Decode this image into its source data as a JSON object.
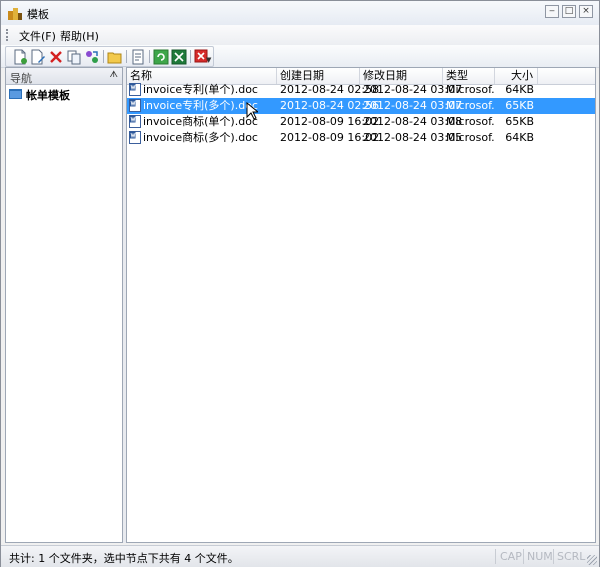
{
  "window": {
    "title": "模板"
  },
  "menu": [
    {
      "label": "文件(F)"
    },
    {
      "label": "帮助(H)"
    }
  ],
  "toolbar": {
    "icons": [
      "new-icon",
      "edit-icon",
      "delete-icon",
      "copy-icon",
      "refresh-sync-icon",
      "folder-open-icon",
      "document-icon",
      "reload-icon",
      "excel-icon",
      "close-red-icon"
    ]
  },
  "nav": {
    "header": "导航",
    "pin_glyph": "ᗑ",
    "items": [
      {
        "label": "帐单模板"
      }
    ]
  },
  "list": {
    "columns": [
      "名称",
      "创建日期",
      "修改日期",
      "类型",
      "大小"
    ],
    "rows": [
      {
        "name": "invoice专利(单个).doc",
        "created": "2012-08-24 02:58",
        "modified": "2012-08-24 03:07",
        "type": "Microsof...",
        "size": "64KB",
        "selected": false
      },
      {
        "name": "invoice专利(多个).doc",
        "created": "2012-08-24 02:56",
        "modified": "2012-08-24 03:07",
        "type": "Microsof...",
        "size": "65KB",
        "selected": true
      },
      {
        "name": "invoice商标(单个).doc",
        "created": "2012-08-09 16:02",
        "modified": "2012-08-24 03:08",
        "type": "Microsof...",
        "size": "65KB",
        "selected": false
      },
      {
        "name": "invoice商标(多个).doc",
        "created": "2012-08-09 16:02",
        "modified": "2012-08-24 03:05",
        "type": "Microsof...",
        "size": "64KB",
        "selected": false
      }
    ]
  },
  "status": {
    "text": "共计: 1 个文件夹，选中节点下共有 4 个文件。",
    "cap": "CAP",
    "num": "NUM",
    "scrl": "SCRL"
  },
  "colors": {
    "selection": "#3399ff",
    "accent": "#2b579a"
  }
}
